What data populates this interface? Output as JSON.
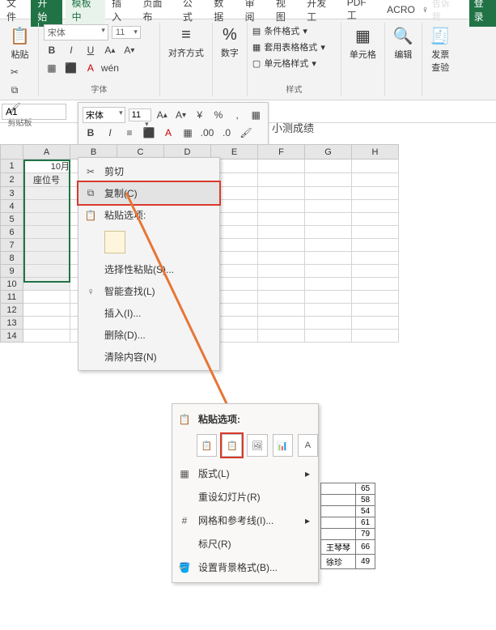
{
  "tabs": [
    "文件",
    "开始",
    "模板中",
    "插入",
    "页面布",
    "公式",
    "数据",
    "审阅",
    "视图",
    "开发工",
    "PDF工",
    "ACRO"
  ],
  "active_tab": 1,
  "tell_me": "告诉我...",
  "login": "登录",
  "ribbon_groups": {
    "clipboard": {
      "paste": "粘贴",
      "label": "剪贴板"
    },
    "font": {
      "name": "宋体",
      "size": "11",
      "label": "字体"
    },
    "align": {
      "label": "对齐方式"
    },
    "number": {
      "symbol": "%",
      "label": "数字"
    },
    "styles": {
      "cond": "条件格式",
      "table": "套用表格格式",
      "cell": "单元格样式",
      "label": "样式"
    },
    "cells": {
      "label": "单元格"
    },
    "editing": {
      "label": "编辑"
    },
    "invoice": {
      "big": "发票",
      "sub": "查验"
    }
  },
  "namebox": "A1",
  "mini_toolbar": {
    "font": "宋体",
    "size": "11"
  },
  "formula_text": "小测成绩",
  "columns": [
    "A",
    "B",
    "C",
    "D",
    "E",
    "F",
    "G",
    "H"
  ],
  "rows": [
    "1",
    "2",
    "3",
    "4",
    "5",
    "6",
    "7",
    "8",
    "9",
    "10",
    "11",
    "12",
    "13",
    "14"
  ],
  "cells": {
    "A1": "10月",
    "A2": "座位号"
  },
  "context_menu": {
    "cut": "剪切",
    "copy": "复制(C)",
    "paste_opts": "粘贴选项:",
    "paste_special": "选择性粘贴(S)...",
    "smart_lookup": "智能查找(L)",
    "insert": "插入(I)...",
    "delete": "删除(D)...",
    "clear": "清除内容(N)"
  },
  "context_menu2": {
    "paste_opts": "粘贴选项:",
    "icons": [
      "",
      "",
      "",
      "",
      ""
    ],
    "layout": "版式(L)",
    "reset": "重设幻灯片(R)",
    "grid": "网格和参考线(I)...",
    "ruler": "标尺(R)",
    "bgfmt": "设置背景格式(B)..."
  },
  "mini_table_rows": [
    "65",
    "58",
    "54",
    "61",
    "79",
    "66",
    "49"
  ],
  "mini_table_left": [
    "",
    "",
    "",
    "",
    "",
    "王琴琴",
    "徐珍"
  ]
}
